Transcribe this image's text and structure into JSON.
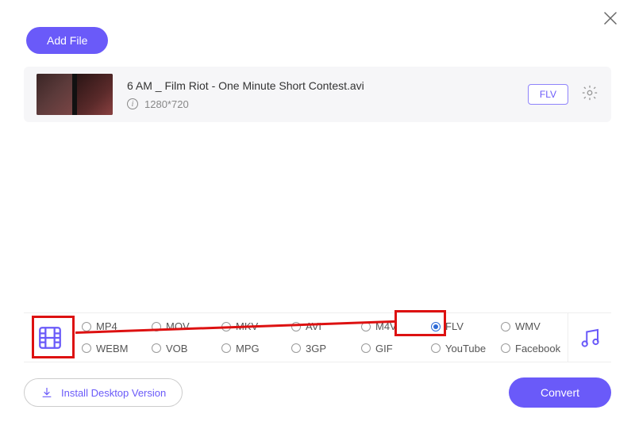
{
  "header": {
    "add_file_label": "Add File"
  },
  "file": {
    "title": "6 AM _ Film Riot - One Minute Short Contest.avi",
    "resolution": "1280*720",
    "output_format": "FLV"
  },
  "formats": {
    "row1": [
      "MP4",
      "MOV",
      "MKV",
      "AVI",
      "M4V",
      "FLV",
      "WMV"
    ],
    "row2": [
      "WEBM",
      "VOB",
      "MPG",
      "3GP",
      "GIF",
      "YouTube",
      "Facebook"
    ],
    "selected": "FLV"
  },
  "footer": {
    "install_label": "Install Desktop Version",
    "convert_label": "Convert"
  }
}
